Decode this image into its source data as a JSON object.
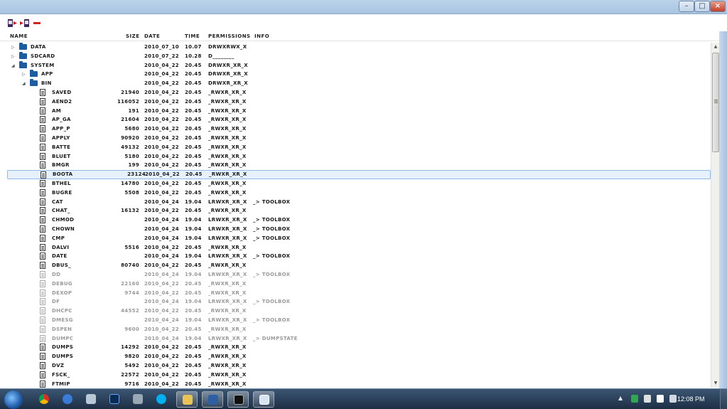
{
  "header": {
    "name": "NAME",
    "size": "SIZE",
    "date": "DATE",
    "time": "TIME",
    "permissions": "PERMISSIONS",
    "info": "INFO"
  },
  "rows": [
    {
      "depth": 0,
      "type": "folder",
      "expander": "collapsed",
      "name": "DATA",
      "size": "",
      "date": "2010_07_10",
      "time": "10.07",
      "perm": "DRWXRWX_X",
      "info": "",
      "dim": false
    },
    {
      "depth": 0,
      "type": "folder",
      "expander": "collapsed",
      "name": "SDCARD",
      "size": "",
      "date": "2010_07_22",
      "time": "10.28",
      "perm": "D________",
      "info": "",
      "dim": false
    },
    {
      "depth": 0,
      "type": "folder",
      "expander": "expanded",
      "name": "SYSTEM",
      "size": "",
      "date": "2010_04_22",
      "time": "20.45",
      "perm": "DRWXR_XR_X",
      "info": "",
      "dim": false
    },
    {
      "depth": 1,
      "type": "folder",
      "expander": "collapsed",
      "name": "APP",
      "size": "",
      "date": "2010_04_22",
      "time": "20.45",
      "perm": "DRWXR_XR_X",
      "info": "",
      "dim": false
    },
    {
      "depth": 1,
      "type": "folder",
      "expander": "expanded",
      "name": "BIN",
      "size": "",
      "date": "2010_04_22",
      "time": "20.45",
      "perm": "DRWXR_XR_X",
      "info": "",
      "dim": false
    },
    {
      "depth": 2,
      "type": "file",
      "expander": "",
      "name": "SAVED",
      "size": "21940",
      "date": "2010_04_22",
      "time": "20.45",
      "perm": "_RWXR_XR_X",
      "info": "",
      "dim": false
    },
    {
      "depth": 2,
      "type": "file",
      "expander": "",
      "name": "AEND2",
      "size": "116052",
      "date": "2010_04_22",
      "time": "20.45",
      "perm": "_RWXR_XR_X",
      "info": "",
      "dim": false
    },
    {
      "depth": 2,
      "type": "file",
      "expander": "",
      "name": "AM",
      "size": "191",
      "date": "2010_04_22",
      "time": "20.45",
      "perm": "_RWXR_XR_X",
      "info": "",
      "dim": false
    },
    {
      "depth": 2,
      "type": "file",
      "expander": "",
      "name": "AP_GA",
      "size": "21604",
      "date": "2010_04_22",
      "time": "20.45",
      "perm": "_RWXR_XR_X",
      "info": "",
      "dim": false
    },
    {
      "depth": 2,
      "type": "file",
      "expander": "",
      "name": "APP_P",
      "size": "5680",
      "date": "2010_04_22",
      "time": "20.45",
      "perm": "_RWXR_XR_X",
      "info": "",
      "dim": false
    },
    {
      "depth": 2,
      "type": "file",
      "expander": "",
      "name": "APPLY",
      "size": "90920",
      "date": "2010_04_22",
      "time": "20.45",
      "perm": "_RWXR_XR_X",
      "info": "",
      "dim": false
    },
    {
      "depth": 2,
      "type": "file",
      "expander": "",
      "name": "BATTE",
      "size": "49132",
      "date": "2010_04_22",
      "time": "20.45",
      "perm": "_RWXR_XR_X",
      "info": "",
      "dim": false
    },
    {
      "depth": 2,
      "type": "file",
      "expander": "",
      "name": "BLUET",
      "size": "5180",
      "date": "2010_04_22",
      "time": "20.45",
      "perm": "_RWXR_XR_X",
      "info": "",
      "dim": false
    },
    {
      "depth": 2,
      "type": "file",
      "expander": "",
      "name": "BMGR",
      "size": "199",
      "date": "2010_04_22",
      "time": "20.45",
      "perm": "_RWXR_XR_X",
      "info": "",
      "dim": false
    },
    {
      "depth": 2,
      "type": "file",
      "expander": "",
      "name": "BOOTA",
      "size": "23124",
      "date": "2010_04_22",
      "time": "20.45",
      "perm": "_RWXR_XR_X",
      "info": "",
      "dim": false,
      "selected": true
    },
    {
      "depth": 2,
      "type": "file",
      "expander": "",
      "name": "BTHEL",
      "size": "14780",
      "date": "2010_04_22",
      "time": "20.45",
      "perm": "_RWXR_XR_X",
      "info": "",
      "dim": false
    },
    {
      "depth": 2,
      "type": "file",
      "expander": "",
      "name": "BUGRE",
      "size": "5508",
      "date": "2010_04_22",
      "time": "20.45",
      "perm": "_RWXR_XR_X",
      "info": "",
      "dim": false
    },
    {
      "depth": 2,
      "type": "file",
      "expander": "",
      "name": "CAT",
      "size": "",
      "date": "2010_04_24",
      "time": "19.04",
      "perm": "LRWXR_XR_X",
      "info": "_> TOOLBOX",
      "dim": false
    },
    {
      "depth": 2,
      "type": "file",
      "expander": "",
      "name": "CHAT_",
      "size": "16132",
      "date": "2010_04_22",
      "time": "20.45",
      "perm": "_RWXR_XR_X",
      "info": "",
      "dim": false
    },
    {
      "depth": 2,
      "type": "file",
      "expander": "",
      "name": "CHMOD",
      "size": "",
      "date": "2010_04_24",
      "time": "19.04",
      "perm": "LRWXR_XR_X",
      "info": "_> TOOLBOX",
      "dim": false
    },
    {
      "depth": 2,
      "type": "file",
      "expander": "",
      "name": "CHOWN",
      "size": "",
      "date": "2010_04_24",
      "time": "19.04",
      "perm": "LRWXR_XR_X",
      "info": "_> TOOLBOX",
      "dim": false
    },
    {
      "depth": 2,
      "type": "file",
      "expander": "",
      "name": "CMP",
      "size": "",
      "date": "2010_04_24",
      "time": "19.04",
      "perm": "LRWXR_XR_X",
      "info": "_> TOOLBOX",
      "dim": false
    },
    {
      "depth": 2,
      "type": "file",
      "expander": "",
      "name": "DALVI",
      "size": "5516",
      "date": "2010_04_22",
      "time": "20.45",
      "perm": "_RWXR_XR_X",
      "info": "",
      "dim": false
    },
    {
      "depth": 2,
      "type": "file",
      "expander": "",
      "name": "DATE",
      "size": "",
      "date": "2010_04_24",
      "time": "19.04",
      "perm": "LRWXR_XR_X",
      "info": "_> TOOLBOX",
      "dim": false
    },
    {
      "depth": 2,
      "type": "file",
      "expander": "",
      "name": "DBUS_",
      "size": "80740",
      "date": "2010_04_22",
      "time": "20.45",
      "perm": "_RWXR_XR_X",
      "info": "",
      "dim": false
    },
    {
      "depth": 2,
      "type": "file",
      "expander": "",
      "name": "DD",
      "size": "",
      "date": "2010_04_24",
      "time": "19.04",
      "perm": "LRWXR_XR_X",
      "info": "_> TOOLBOX",
      "dim": true
    },
    {
      "depth": 2,
      "type": "file",
      "expander": "",
      "name": "DEBUG",
      "size": "22160",
      "date": "2010_04_22",
      "time": "20.45",
      "perm": "_RWXR_XR_X",
      "info": "",
      "dim": true
    },
    {
      "depth": 2,
      "type": "file",
      "expander": "",
      "name": "DEXOP",
      "size": "9744",
      "date": "2010_04_22",
      "time": "20.45",
      "perm": "_RWXR_XR_X",
      "info": "",
      "dim": true
    },
    {
      "depth": 2,
      "type": "file",
      "expander": "",
      "name": "DF",
      "size": "",
      "date": "2010_04_24",
      "time": "19.04",
      "perm": "LRWXR_XR_X",
      "info": "_> TOOLBOX",
      "dim": true
    },
    {
      "depth": 2,
      "type": "file",
      "expander": "",
      "name": "DHCPC",
      "size": "44552",
      "date": "2010_04_22",
      "time": "20.45",
      "perm": "_RWXR_XR_X",
      "info": "",
      "dim": true
    },
    {
      "depth": 2,
      "type": "file",
      "expander": "",
      "name": "DMESG",
      "size": "",
      "date": "2010_04_24",
      "time": "19.04",
      "perm": "LRWXR_XR_X",
      "info": "_> TOOLBOX",
      "dim": true
    },
    {
      "depth": 2,
      "type": "file",
      "expander": "",
      "name": "DSPEN",
      "size": "9600",
      "date": "2010_04_22",
      "time": "20.45",
      "perm": "_RWXR_XR_X",
      "info": "",
      "dim": true
    },
    {
      "depth": 2,
      "type": "file",
      "expander": "",
      "name": "DUMPC",
      "size": "",
      "date": "2010_04_24",
      "time": "19.04",
      "perm": "LRWXR_XR_X",
      "info": "_> DUMPSTATE",
      "dim": true
    },
    {
      "depth": 2,
      "type": "file",
      "expander": "",
      "name": "DUMPS",
      "size": "14292",
      "date": "2010_04_22",
      "time": "20.45",
      "perm": "_RWXR_XR_X",
      "info": "",
      "dim": false
    },
    {
      "depth": 2,
      "type": "file",
      "expander": "",
      "name": "DUMPS",
      "size": "9820",
      "date": "2010_04_22",
      "time": "20.45",
      "perm": "_RWXR_XR_X",
      "info": "",
      "dim": false
    },
    {
      "depth": 2,
      "type": "file",
      "expander": "",
      "name": "DVZ",
      "size": "5492",
      "date": "2010_04_22",
      "time": "20.45",
      "perm": "_RWXR_XR_X",
      "info": "",
      "dim": false
    },
    {
      "depth": 2,
      "type": "file",
      "expander": "",
      "name": "FSCK_",
      "size": "22572",
      "date": "2010_04_22",
      "time": "20.45",
      "perm": "_RWXR_XR_X",
      "info": "",
      "dim": false
    },
    {
      "depth": 2,
      "type": "file",
      "expander": "",
      "name": "FTMIP",
      "size": "9716",
      "date": "2010_04_22",
      "time": "20.45",
      "perm": "_RWXR_XR_X",
      "info": "",
      "dim": false
    }
  ],
  "taskbar": {
    "clock": "12:08 PM"
  },
  "icons": {
    "toolbar": [
      "pull-icon",
      "push-icon",
      "delete-icon"
    ],
    "taskbar": [
      "start-orb-icon",
      "chrome-icon",
      "world-icon",
      "winamp-icon",
      "photoshop-icon",
      "daemon-icon",
      "skype-icon",
      "explorer-icon",
      "java-icon",
      "cmd-icon",
      "app-window-icon"
    ]
  },
  "colors": {
    "selection": "#e6f1fb",
    "folder": "#1e5c9e",
    "delete": "#d21f1f"
  }
}
